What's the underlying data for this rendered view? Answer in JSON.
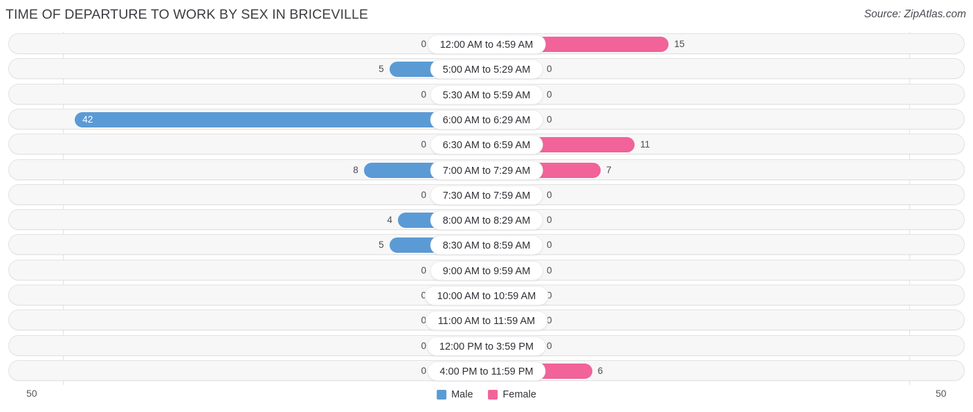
{
  "header": {
    "title": "TIME OF DEPARTURE TO WORK BY SEX IN BRICEVILLE",
    "source": "Source: ZipAtlas.com"
  },
  "legend": {
    "male_label": "Male",
    "female_label": "Female",
    "male_color": "#5b9bd5",
    "female_color": "#f2639a"
  },
  "axis": {
    "left_tick": "50",
    "right_tick": "50"
  },
  "chart_data": {
    "type": "bar",
    "title": "TIME OF DEPARTURE TO WORK BY SEX IN BRICEVILLE",
    "orientation": "horizontal-diverging",
    "xlabel": "",
    "ylabel": "",
    "xlim": [
      50,
      50
    ],
    "grid": false,
    "legend_position": "bottom-center",
    "categories": [
      "12:00 AM to 4:59 AM",
      "5:00 AM to 5:29 AM",
      "5:30 AM to 5:59 AM",
      "6:00 AM to 6:29 AM",
      "6:30 AM to 6:59 AM",
      "7:00 AM to 7:29 AM",
      "7:30 AM to 7:59 AM",
      "8:00 AM to 8:29 AM",
      "8:30 AM to 8:59 AM",
      "9:00 AM to 9:59 AM",
      "10:00 AM to 10:59 AM",
      "11:00 AM to 11:59 AM",
      "12:00 PM to 3:59 PM",
      "4:00 PM to 11:59 PM"
    ],
    "series": [
      {
        "name": "Male",
        "color": "#9fc5e8",
        "accent_color": "#5b9bd5",
        "values": [
          0,
          5,
          0,
          42,
          0,
          8,
          0,
          4,
          5,
          0,
          0,
          0,
          0,
          0
        ]
      },
      {
        "name": "Female",
        "color": "#f7a8c4",
        "accent_color": "#f2639a",
        "values": [
          15,
          0,
          0,
          0,
          11,
          7,
          0,
          0,
          0,
          0,
          0,
          0,
          0,
          6
        ]
      }
    ]
  },
  "rows": [
    {
      "label": "12:00 AM to 4:59 AM",
      "male": "0",
      "female": "15"
    },
    {
      "label": "5:00 AM to 5:29 AM",
      "male": "5",
      "female": "0"
    },
    {
      "label": "5:30 AM to 5:59 AM",
      "male": "0",
      "female": "0"
    },
    {
      "label": "6:00 AM to 6:29 AM",
      "male": "42",
      "female": "0"
    },
    {
      "label": "6:30 AM to 6:59 AM",
      "male": "0",
      "female": "11"
    },
    {
      "label": "7:00 AM to 7:29 AM",
      "male": "8",
      "female": "7"
    },
    {
      "label": "7:30 AM to 7:59 AM",
      "male": "0",
      "female": "0"
    },
    {
      "label": "8:00 AM to 8:29 AM",
      "male": "4",
      "female": "0"
    },
    {
      "label": "8:30 AM to 8:59 AM",
      "male": "5",
      "female": "0"
    },
    {
      "label": "9:00 AM to 9:59 AM",
      "male": "0",
      "female": "0"
    },
    {
      "label": "10:00 AM to 10:59 AM",
      "male": "0",
      "female": "0"
    },
    {
      "label": "11:00 AM to 11:59 AM",
      "male": "0",
      "female": "0"
    },
    {
      "label": "12:00 PM to 3:59 PM",
      "male": "0",
      "female": "0"
    },
    {
      "label": "4:00 PM to 11:59 PM",
      "male": "0",
      "female": "6"
    }
  ]
}
